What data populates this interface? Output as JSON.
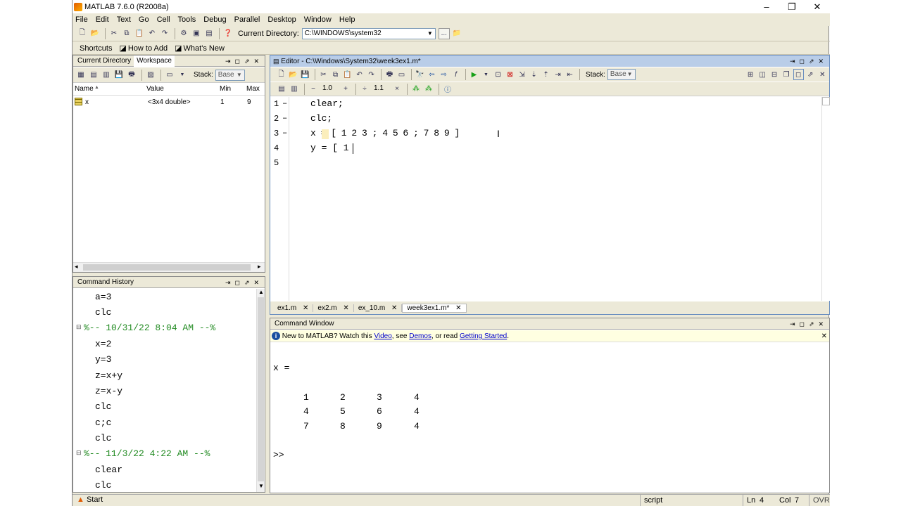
{
  "window": {
    "title": "MATLAB  7.6.0 (R2008a)",
    "minimize": "–",
    "maximize": "❐",
    "close": "✕"
  },
  "menu": [
    "File",
    "Edit",
    "Text",
    "Go",
    "Cell",
    "Tools",
    "Debug",
    "Parallel",
    "Desktop",
    "Window",
    "Help"
  ],
  "toolbar": {
    "current_dir_label": "Current Directory:",
    "current_dir_value": "C:\\WINDOWS\\system32",
    "browse_label": "..."
  },
  "shortcuts": {
    "shortcuts": "Shortcuts",
    "how_to_add": "How to Add",
    "whats_new": "What's New"
  },
  "left_top": {
    "tab1": "Current Directory",
    "tab2": "Workspace",
    "stack_label": "Stack:",
    "stack_value": "Base",
    "columns": [
      "Name",
      "Value",
      "Min",
      "Max"
    ],
    "rows": [
      {
        "name": "x",
        "value": "<3x4 double>",
        "min": "1",
        "max": "9"
      }
    ]
  },
  "history": {
    "title": "Command History",
    "lines": [
      {
        "text": "a=3",
        "type": "cmd"
      },
      {
        "text": "clc",
        "type": "cmd"
      },
      {
        "text": "%-- 10/31/22  8:04 AM --%",
        "type": "session"
      },
      {
        "text": "x=2",
        "type": "cmd"
      },
      {
        "text": "y=3",
        "type": "cmd"
      },
      {
        "text": "z=x+y",
        "type": "cmd"
      },
      {
        "text": "z=x-y",
        "type": "cmd"
      },
      {
        "text": "clc",
        "type": "cmd"
      },
      {
        "text": "c;c",
        "type": "cmd"
      },
      {
        "text": "clc",
        "type": "cmd"
      },
      {
        "text": "%-- 11/3/22  4:22 AM --%",
        "type": "session"
      },
      {
        "text": "clear",
        "type": "cmd"
      },
      {
        "text": "clc",
        "type": "cmd"
      }
    ]
  },
  "editor": {
    "title": "Editor - C:\\Windows\\System32\\week3ex1.m*",
    "stack_label": "Stack:",
    "stack_value": "Base",
    "cell_val1": "1.0",
    "cell_val2": "1.1",
    "lines": [
      {
        "num": "1",
        "text": "clear;"
      },
      {
        "num": "2",
        "text": "clc;"
      },
      {
        "num": "3",
        "text": "x = [ 1 2 3 ; 4 5 6 ; 7 8 9 ]"
      },
      {
        "num": "4",
        "text": "y = [ 1"
      },
      {
        "num": "5",
        "text": ""
      }
    ],
    "tabs": [
      "ex1.m",
      "ex2.m",
      "ex_10.m",
      "week3ex1.m*"
    ]
  },
  "command": {
    "title": "Command Window",
    "info": {
      "pre": "New to MATLAB? Watch this ",
      "video": "Video",
      "mid1": ", see ",
      "demos": "Demos",
      "mid2": ", or read ",
      "getting_started": "Getting Started",
      "end": "."
    },
    "output_var": "x =",
    "matrix": [
      [
        "1",
        "2",
        "3",
        "4"
      ],
      [
        "4",
        "5",
        "6",
        "4"
      ],
      [
        "7",
        "8",
        "9",
        "4"
      ]
    ],
    "prompt": ">>"
  },
  "status": {
    "start": "Start",
    "mode": "script",
    "ln_label": "Ln",
    "ln": "4",
    "col_label": "Col",
    "col": "7",
    "ovr": "OVR"
  }
}
